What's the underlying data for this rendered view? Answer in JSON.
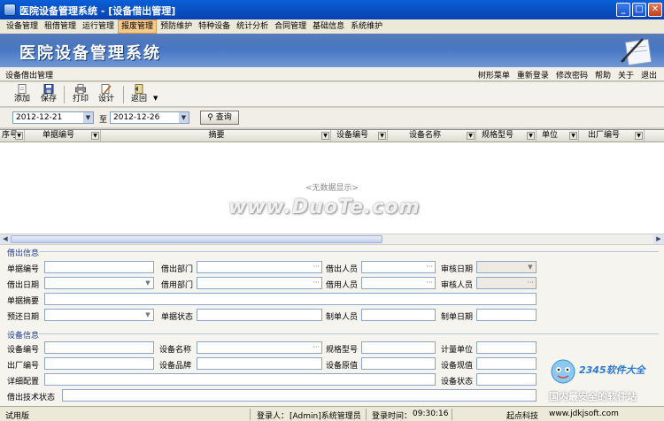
{
  "window": {
    "title": "医院设备管理系统 - [设备借出管理]"
  },
  "menu": [
    "设备管理",
    "租借管理",
    "运行管理",
    "报废管理",
    "预防维护",
    "特种设备",
    "统计分析",
    "合同管理",
    "基础信息",
    "系统维护"
  ],
  "menu_active": "报废管理",
  "banner": {
    "app_name": "医院设备管理系统"
  },
  "module_bar": {
    "module": "设备借出管理",
    "links": [
      "树形菜单",
      "重新登录",
      "修改密码",
      "帮助",
      "关于",
      "退出"
    ]
  },
  "toolbar": {
    "add": "添加",
    "save": "保存",
    "print": "打印",
    "design": "设计",
    "back": "返回"
  },
  "filter": {
    "date_from": "2012-12-21",
    "to": "至",
    "date_to": "2012-12-26",
    "query": "查询"
  },
  "grid": {
    "columns": [
      "序号",
      "单据编号",
      "摘要",
      "设备编号",
      "设备名称",
      "规格型号",
      "单位",
      "出厂编号"
    ],
    "empty": "<无数据显示>"
  },
  "watermark": "www.DuoTe.com",
  "borrow_section": {
    "title": "借出信息",
    "doc_no": "单据编号",
    "borrow_dept": "借出部门",
    "borrow_person": "借出人员",
    "audit_date": "审核日期",
    "borrow_date": "借出日期",
    "use_dept": "借用部门",
    "use_person": "借用人员",
    "audit_person": "审核人员",
    "summary": "单据摘要",
    "return_date": "预还日期",
    "doc_status": "单据状态",
    "maker": "制单人员",
    "make_date": "制单日期"
  },
  "device_section": {
    "title": "设备信息",
    "device_no": "设备编号",
    "device_name": "设备名称",
    "spec": "规格型号",
    "unit": "计量单位",
    "factory_no": "出厂编号",
    "brand": "设备品牌",
    "orig_value": "设备原值",
    "cur_value": "设备现值",
    "config": "详细配置",
    "device_status": "设备状态",
    "tech_status": "借出技术状态"
  },
  "logo_2345": {
    "brand": "2345软件大全",
    "slogan": "国内最安全的软件站"
  },
  "status": {
    "mode": "试用版",
    "login_label": "登录人：",
    "login_user": "[Admin]系统管理员",
    "time_label": "登录时间：",
    "time": "09:30:16",
    "company": "起点科技",
    "url": "www.jdkjsoft.com"
  },
  "colors": {
    "title_bar": "#0842b0",
    "banner": "#2a58a8",
    "section_title": "#1c3f94",
    "active_menu": "#f6c98a"
  }
}
